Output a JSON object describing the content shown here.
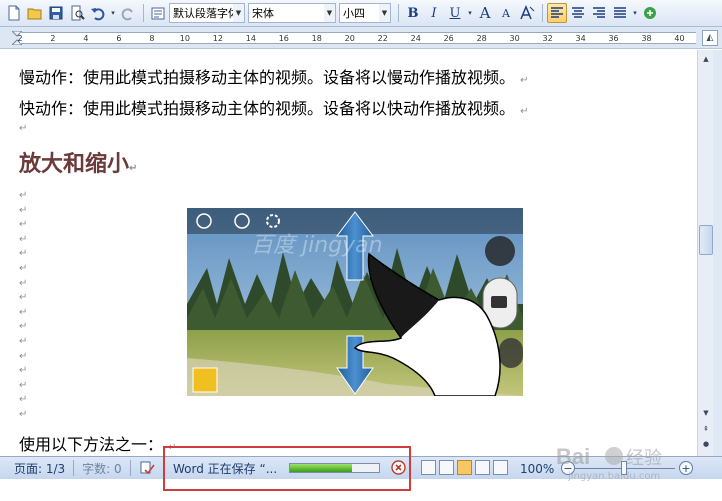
{
  "toolbar": {
    "style_value": "默认段落字体",
    "font_value": "宋体",
    "size_value": "小四",
    "bold_label": "B",
    "italic_label": "I",
    "underline_label": "U",
    "grow_font_label": "A",
    "shrink_font_label": "A"
  },
  "ruler": {
    "numbers": [
      "2",
      "2",
      "4",
      "6",
      "8",
      "10",
      "12",
      "14",
      "16",
      "18",
      "20",
      "22",
      "24",
      "26",
      "28",
      "30",
      "32",
      "34",
      "36",
      "38",
      "40"
    ]
  },
  "document": {
    "para1": "慢动作：使用此模式拍摄移动主体的视频。设备将以慢动作播放视频。",
    "para2": "快动作：使用此模式拍摄移动主体的视频。设备将以快动作播放视频。",
    "heading": "放大和缩小",
    "para_last": "使用以下方法之一：",
    "paragraph_mark": "↵",
    "watermark_text": "百度 jingyan"
  },
  "status": {
    "page": "页面: 1/3",
    "words": "字数: 0",
    "saving": "Word 正在保存 “...",
    "progress": 0.7,
    "zoom": "100%",
    "zoom_minus": "−",
    "zoom_plus": "+"
  },
  "colors": {
    "heading": "#6b3a3a",
    "highlight": "#d23b3b",
    "progress": "#3b9d15"
  },
  "watermark": {
    "brand": "Bai",
    "brand_suffix": "经验",
    "url": "jingyan.baidu.com"
  }
}
